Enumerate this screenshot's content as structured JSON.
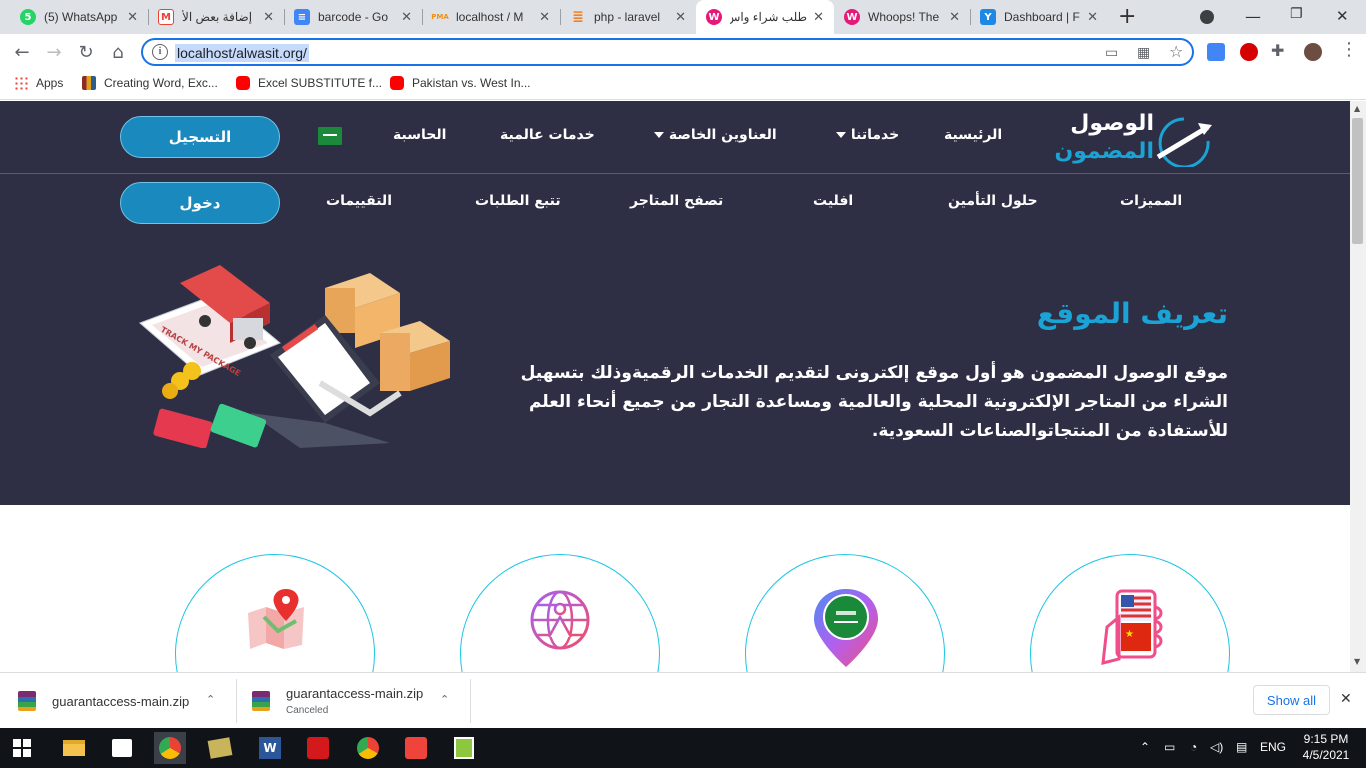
{
  "tabs": [
    {
      "title": "(5) WhatsApp",
      "icon": "whatsapp-icon",
      "color": "#25d366",
      "glyph": "5"
    },
    {
      "title": "إضافة بعض الأ",
      "icon": "gmail-icon",
      "color": "#ea4335",
      "glyph": "M"
    },
    {
      "title": "barcode - Go",
      "icon": "docs-icon",
      "color": "#4285f4",
      "glyph": "≡"
    },
    {
      "title": "localhost / M",
      "icon": "phpmyadmin-icon",
      "color": "#f29111",
      "glyph": "PMA"
    },
    {
      "title": "php - laravel",
      "icon": "stackoverflow-icon",
      "color": "#f48024",
      "glyph": "≣"
    },
    {
      "title": "طلب شراء واس",
      "icon": "site-icon",
      "color": "#e6197a",
      "glyph": "W"
    },
    {
      "title": "Whoops! The",
      "icon": "site-icon",
      "color": "#e6197a",
      "glyph": "W"
    },
    {
      "title": "Dashboard | F",
      "icon": "dashboard-icon",
      "color": "#1e88e5",
      "glyph": "Y"
    }
  ],
  "address": {
    "url": "localhost/alwasit.org/"
  },
  "bookmarks": [
    {
      "label": "Apps",
      "icon": "apps-icon"
    },
    {
      "label": "Creating Word, Exc...",
      "icon": "books-icon"
    },
    {
      "label": "Excel SUBSTITUTE f...",
      "icon": "youtube-icon"
    },
    {
      "label": "Pakistan vs. West In...",
      "icon": "youtube-icon"
    }
  ],
  "site": {
    "logo": {
      "line1": "الوصول",
      "line2": "المضمون"
    },
    "nav_top": {
      "home": "الرئيسية",
      "services": "خدماتنا",
      "addresses": "العناوين الخاصة",
      "global": "خدمات عالمية",
      "calculator": "الحاسبة",
      "register": "التسجيل"
    },
    "nav_bottom": {
      "features": "المميزات",
      "insurance": "حلول التأمين",
      "affiliate": "افليت",
      "stores": "تصفح المتاجر",
      "tracking": "تتبع الطلبات",
      "ratings": "التقييمات",
      "login": "دخول"
    },
    "hero": {
      "title": "تعريف الموقع",
      "text": "موقع الوصول المضمون هو أول موقع إلكترونى لتقديم الخدمات الرقميةوذلك بتسهيل الشراء من المتاجر الإلكترونية المحلية والعالمية ومساعدة التجار من جميع أنحاء العلم للأستفادة من المنتجاتوالصناعات السعودية.",
      "illustration_sign": "TRACK MY PACKAGE"
    },
    "feature_icons": [
      "map-pin-icon",
      "globe-people-icon",
      "saudi-location-icon",
      "phone-flags-icon"
    ],
    "colors": {
      "hero_bg": "#2e2f44",
      "accent": "#1aa3d4",
      "button": "#1a89bd",
      "circle_border": "#1cc6e3"
    }
  },
  "downloads": [
    {
      "name": "guarantaccess-main.zip",
      "status": ""
    },
    {
      "name": "guarantaccess-main.zip",
      "status": "Canceled"
    }
  ],
  "downloads_show_all": "Show all",
  "taskbar": {
    "lang": "ENG",
    "time": "9:15 PM",
    "date": "4/5/2021"
  }
}
